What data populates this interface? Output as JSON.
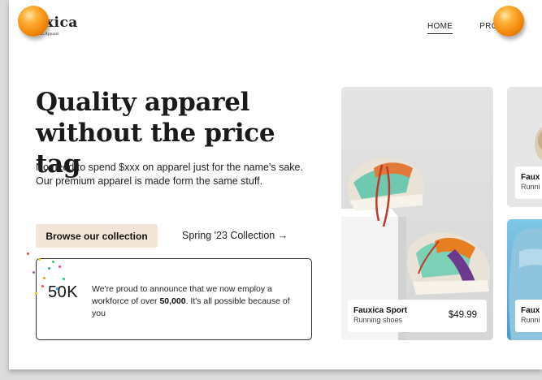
{
  "brand": {
    "name": "uxica",
    "tagline": "mium Apparel"
  },
  "nav": {
    "items": [
      "HOME",
      "PRO"
    ]
  },
  "hero": {
    "title": "Quality apparel without the price tag",
    "description": "No need to spend $xxx on apparel just for the name's sake. Our premium apparel is made form the same stuff.",
    "browse_label": "Browse our collection",
    "collection_link": "Spring '23 Collection →"
  },
  "stat": {
    "number": "50K",
    "text_before": "We're proud to announce that we now employ a workforce of over ",
    "text_bold": "50,000",
    "text_after": ". It's all possible because of you"
  },
  "products": {
    "main": {
      "name": "Fauxica Sport",
      "subtitle": "Running shoes",
      "price": "$49.99"
    },
    "side1": {
      "name": "Faux",
      "subtitle": "Runni"
    },
    "side2": {
      "name": "Faux",
      "subtitle": "Runni"
    }
  },
  "colors": {
    "accent": "#f3e6d8",
    "ball": "#f28a0c",
    "side_card": "#4a9cc9"
  }
}
